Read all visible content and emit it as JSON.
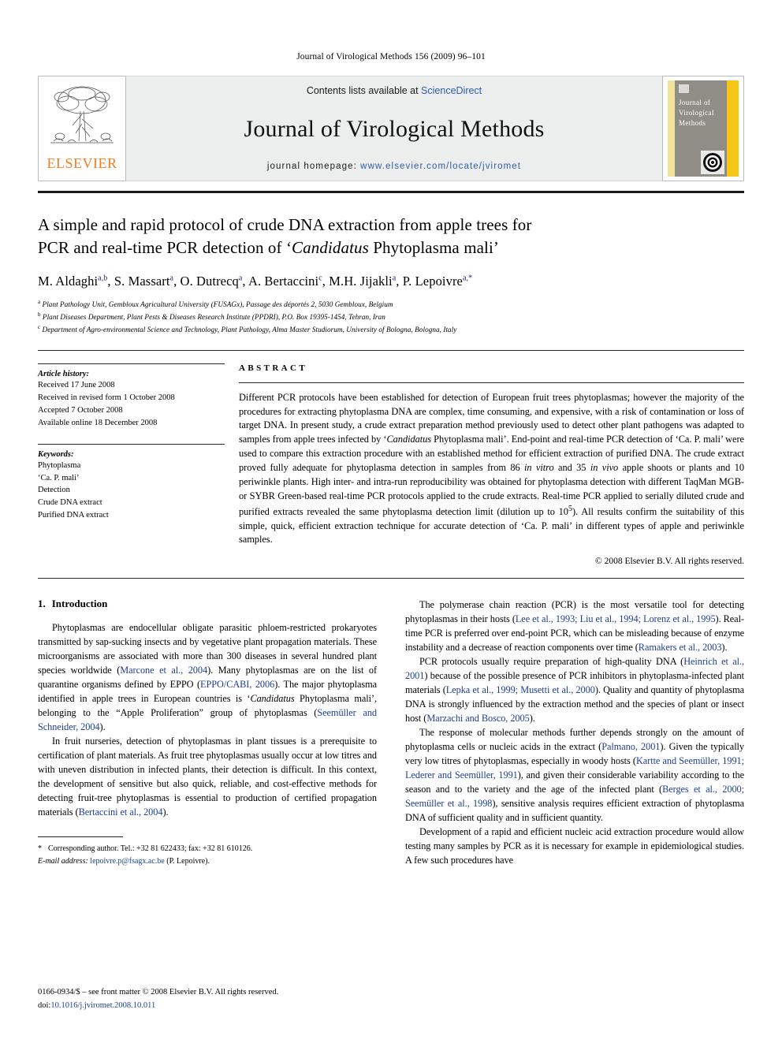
{
  "running_head": "Journal of Virological Methods 156 (2009) 96–101",
  "banner": {
    "publisher_name": "ELSEVIER",
    "contents_prefix": "Contents lists available at ",
    "contents_link": "ScienceDirect",
    "journal_title": "Journal of Virological Methods",
    "homepage_prefix": "journal homepage: ",
    "homepage_url": "www.elsevier.com/locate/jviromet",
    "cover": {
      "line1": "Journal of",
      "line2": "Virological",
      "line3": "Methods"
    }
  },
  "article": {
    "title_line1": "A simple and rapid protocol of crude DNA extraction from apple trees for",
    "title_line2_pre": "PCR and real-time PCR detection of ‘",
    "title_line2_em": "Candidatus",
    "title_line2_post": " Phytoplasma mali’",
    "authors": [
      {
        "name": "M. Aldaghi",
        "sup": "a,b",
        "sep": ", "
      },
      {
        "name": "S. Massart",
        "sup": "a",
        "sep": ", "
      },
      {
        "name": "O. Dutrecq",
        "sup": "a",
        "sep": ", "
      },
      {
        "name": "A. Bertaccini",
        "sup": "c",
        "sep": ", "
      },
      {
        "name": "M.H. Jijakli",
        "sup": "a",
        "sep": ", "
      },
      {
        "name": "P. Lepoivre",
        "sup": "a,*",
        "sep": ""
      }
    ],
    "affiliations": [
      {
        "marker": "a",
        "text": "Plant Pathology Unit, Gembloux Agricultural University (FUSAGx), Passage des déportés 2, 5030 Gembloux, Belgium"
      },
      {
        "marker": "b",
        "text": "Plant Diseases Department, Plant Pests & Diseases Research Institute (PPDRI), P.O. Box 19395-1454, Tehran, Iran"
      },
      {
        "marker": "c",
        "text": "Department of Agro-environmental Science and Technology, Plant Pathology, Alma Master Studiorum, University of Bologna, Bologna, Italy"
      }
    ]
  },
  "article_info": {
    "history_heading": "Article history:",
    "history": [
      "Received 17 June 2008",
      "Received in revised form 1 October 2008",
      "Accepted 7 October 2008",
      "Available online 18 December 2008"
    ],
    "keywords_heading": "Keywords:",
    "keywords": [
      "Phytoplasma",
      "‘Ca. P. mali’",
      "Detection",
      "Crude DNA extract",
      "Purified DNA extract"
    ]
  },
  "abstract": {
    "label": "ABSTRACT",
    "part1": "Different PCR protocols have been established for detection of European fruit trees phytoplasmas; however the majority of the procedures for extracting phytoplasma DNA are complex, time consuming, and expensive, with a risk of contamination or loss of target DNA. In present study, a crude extract preparation method previously used to detect other plant pathogens was adapted to samples from apple trees infected by ‘",
    "em1": "Candidatus",
    "part2": " Phytoplasma mali’. End-point and real-time PCR detection of ‘Ca. P. mali’ were used to compare this extraction procedure with an established method for efficient extraction of purified DNA. The crude extract proved fully adequate for phytoplasma detection in samples from 86 ",
    "em2": "in vitro",
    "part3": " and 35 ",
    "em3": "in vivo",
    "part4": " apple shoots or plants and 10 periwinkle plants. High inter- and intra-run reproducibility was obtained for phytoplasma detection with different TaqMan MGB- or SYBR Green-based real-time PCR protocols applied to the crude extracts. Real-time PCR applied to serially diluted crude and purified extracts revealed the same phytoplasma detection limit (dilution up to 10",
    "sup1": "5",
    "part5": "). All results confirm the suitability of this simple, quick, efficient extraction technique for accurate detection of ‘Ca. P. mali’ in different types of apple and periwinkle samples.",
    "copyright": "© 2008 Elsevier B.V. All rights reserved."
  },
  "introduction": {
    "number": "1.",
    "heading": "Introduction",
    "left_paragraphs": [
      {
        "segments": [
          {
            "t": "Phytoplasmas are endocellular obligate parasitic phloem-restricted prokaryotes transmitted by sap-sucking insects and by vegetative plant propagation materials. These microorganisms are associated with more than 300 diseases in several hundred plant species worldwide (",
            "k": "text"
          },
          {
            "t": "Marcone et al., 2004",
            "k": "cite"
          },
          {
            "t": "). Many phytoplasmas are on the list of quarantine organisms defined by EPPO (",
            "k": "text"
          },
          {
            "t": "EPPO/CABI, 2006",
            "k": "cite"
          },
          {
            "t": "). The major phytoplasma identified in apple trees in European countries is ‘",
            "k": "text"
          },
          {
            "t": "Candidatus",
            "k": "em"
          },
          {
            "t": " Phytoplasma mali’, belonging to the “Apple Proliferation” group of phytoplasmas (",
            "k": "text"
          },
          {
            "t": "Seemüller and Schneider, 2004",
            "k": "cite"
          },
          {
            "t": ").",
            "k": "text"
          }
        ]
      },
      {
        "segments": [
          {
            "t": "In fruit nurseries, detection of phytoplasmas in plant tissues is a prerequisite to certification of plant materials. As fruit tree phytoplasmas usually occur at low titres and with uneven distribution in infected plants, their detection is difficult. In this context, the development of sensitive but also quick, reliable, and cost-effective methods for detecting fruit-tree phytoplasmas is essential to production of certified propagation materials (",
            "k": "text"
          },
          {
            "t": "Bertaccini et al., 2004",
            "k": "cite"
          },
          {
            "t": ").",
            "k": "text"
          }
        ]
      }
    ],
    "right_paragraphs": [
      {
        "segments": [
          {
            "t": "The polymerase chain reaction (PCR) is the most versatile tool for detecting phytoplasmas in their hosts (",
            "k": "text"
          },
          {
            "t": "Lee et al., 1993; Liu et al., 1994; Lorenz et al., 1995",
            "k": "cite"
          },
          {
            "t": "). Real-time PCR is preferred over end-point PCR, which can be misleading because of enzyme instability and a decrease of reaction components over time (",
            "k": "text"
          },
          {
            "t": "Ramakers et al., 2003",
            "k": "cite"
          },
          {
            "t": ").",
            "k": "text"
          }
        ]
      },
      {
        "segments": [
          {
            "t": "PCR protocols usually require preparation of high-quality DNA (",
            "k": "text"
          },
          {
            "t": "Heinrich et al., 2001",
            "k": "cite"
          },
          {
            "t": ") because of the possible presence of PCR inhibitors in phytoplasma-infected plant materials (",
            "k": "text"
          },
          {
            "t": "Lepka et al., 1999; Musetti et al., 2000",
            "k": "cite"
          },
          {
            "t": "). Quality and quantity of phytoplasma DNA is strongly influenced by the extraction method and the species of plant or insect host (",
            "k": "text"
          },
          {
            "t": "Marzachi and Bosco, 2005",
            "k": "cite"
          },
          {
            "t": ").",
            "k": "text"
          }
        ]
      },
      {
        "segments": [
          {
            "t": "The response of molecular methods further depends strongly on the amount of phytoplasma cells or nucleic acids in the extract (",
            "k": "text"
          },
          {
            "t": "Palmano, 2001",
            "k": "cite"
          },
          {
            "t": "). Given the typically very low titres of phytoplasmas, especially in woody hosts (",
            "k": "text"
          },
          {
            "t": "Kartte and Seemüller, 1991; Lederer and Seemüller, 1991",
            "k": "cite"
          },
          {
            "t": "), and given their considerable variability according to the season and to the variety and the age of the infected plant (",
            "k": "text"
          },
          {
            "t": "Berges et al., 2000; Seemüller et al., 1998",
            "k": "cite"
          },
          {
            "t": "), sensitive analysis requires efficient extraction of phytoplasma DNA of sufficient quality and in sufficient quantity.",
            "k": "text"
          }
        ]
      },
      {
        "segments": [
          {
            "t": "Development of a rapid and efficient nucleic acid extraction procedure would allow testing many samples by PCR as it is necessary for example in epidemiological studies. A few such procedures have",
            "k": "text"
          }
        ]
      }
    ]
  },
  "footnote": {
    "star": "*",
    "corresponding": "Corresponding author. Tel.: +32 81 622433; fax: +32 81 610126.",
    "email_label": "E-mail address:",
    "email": "lepoivre.p@fsagx.ac.be",
    "email_owner": "(P. Lepoivre)."
  },
  "footer": {
    "issn_line": "0166-0934/$ – see front matter © 2008 Elsevier B.V. All rights reserved.",
    "doi_label": "doi:",
    "doi_value": "10.1016/j.jviromet.2008.10.011"
  }
}
